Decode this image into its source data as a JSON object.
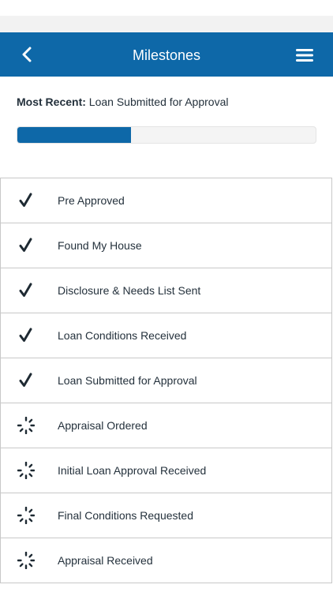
{
  "header": {
    "title": "Milestones",
    "back_icon": "chevron-left-icon",
    "menu_icon": "hamburger-menu-icon"
  },
  "summary": {
    "label": "Most Recent:",
    "value": "Loan Submitted for Approval",
    "progress_percent": 38
  },
  "colors": {
    "brand": "#0e68a8",
    "text": "#24313c",
    "divider": "#c8c8c8"
  },
  "milestones": [
    {
      "label": "Pre Approved",
      "status": "complete",
      "icon": "checkmark-icon"
    },
    {
      "label": "Found My House",
      "status": "complete",
      "icon": "checkmark-icon"
    },
    {
      "label": "Disclosure & Needs List Sent",
      "status": "complete",
      "icon": "checkmark-icon"
    },
    {
      "label": "Loan Conditions Received",
      "status": "complete",
      "icon": "checkmark-icon"
    },
    {
      "label": "Loan Submitted for Approval",
      "status": "complete",
      "icon": "checkmark-icon"
    },
    {
      "label": "Appraisal Ordered",
      "status": "pending",
      "icon": "pending-spinner-icon"
    },
    {
      "label": "Initial Loan Approval Received",
      "status": "pending",
      "icon": "pending-spinner-icon"
    },
    {
      "label": "Final Conditions Requested",
      "status": "pending",
      "icon": "pending-spinner-icon"
    },
    {
      "label": "Appraisal Received",
      "status": "pending",
      "icon": "pending-spinner-icon"
    }
  ]
}
